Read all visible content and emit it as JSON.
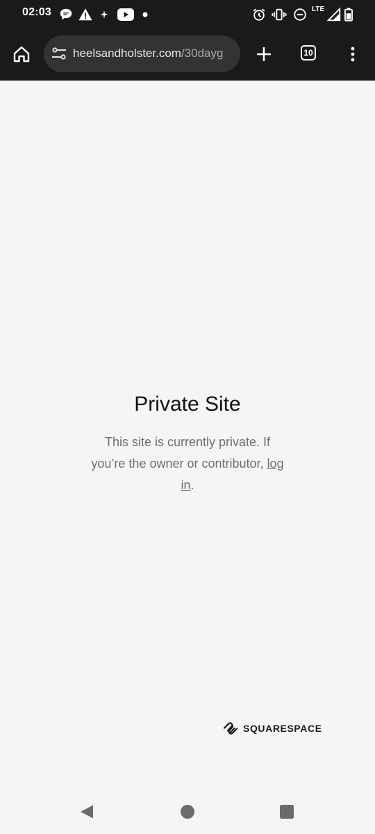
{
  "status_bar": {
    "time": "02:03",
    "network": "LTE",
    "left_icons": [
      "chat-bubble-icon",
      "warning-icon",
      "sparkle-icon",
      "youtube-icon",
      "notification-dot-icon"
    ],
    "right_icons": [
      "alarm-icon",
      "vibrate-icon",
      "do-not-disturb-icon",
      "signal-icon",
      "battery-icon"
    ]
  },
  "toolbar": {
    "url_domain": "heelsandholster.com",
    "url_path": "/30dayg",
    "tab_count": "10",
    "icons": [
      "home-icon",
      "tune-icon",
      "plus-icon",
      "tab-switcher-icon",
      "more-vert-icon"
    ]
  },
  "page": {
    "title": "Private Site",
    "message_line1": "This site is currently private. If you’re the owner or contributor,",
    "login_link": "log in",
    "message_end": ".",
    "brand": "SQUARESPACE"
  },
  "nav": {
    "icons": [
      "back-icon",
      "home-circle-icon",
      "recents-icon"
    ]
  },
  "colors": {
    "chrome_bg": "#1a1a1a",
    "url_pill_bg": "#333336",
    "page_bg": "#f5f5f5",
    "title_text": "#111111",
    "body_text": "#6e6e6e"
  }
}
